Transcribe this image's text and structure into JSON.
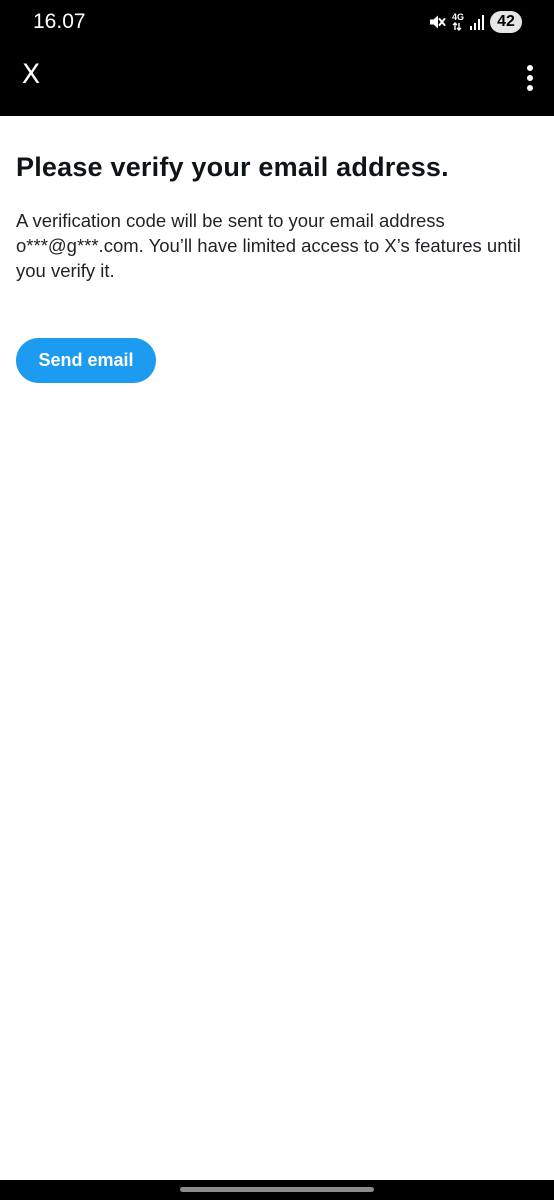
{
  "status_bar": {
    "time": "16.07",
    "network": "4G",
    "battery": "42",
    "icons": [
      "mute-icon",
      "network-4g-icon",
      "signal-icon",
      "battery-icon"
    ]
  },
  "app_bar": {
    "close_icon": "X",
    "menu_icon": "more-vertical-icon",
    "background": "#000000"
  },
  "main": {
    "title": "Please verify your email address.",
    "body": "A verification code will be sent to your email address o***@g***.com. You’ll have limited access to X’s features until you verify it.",
    "send_button_label": "Send email",
    "accent_color": "#1d9bf0"
  }
}
